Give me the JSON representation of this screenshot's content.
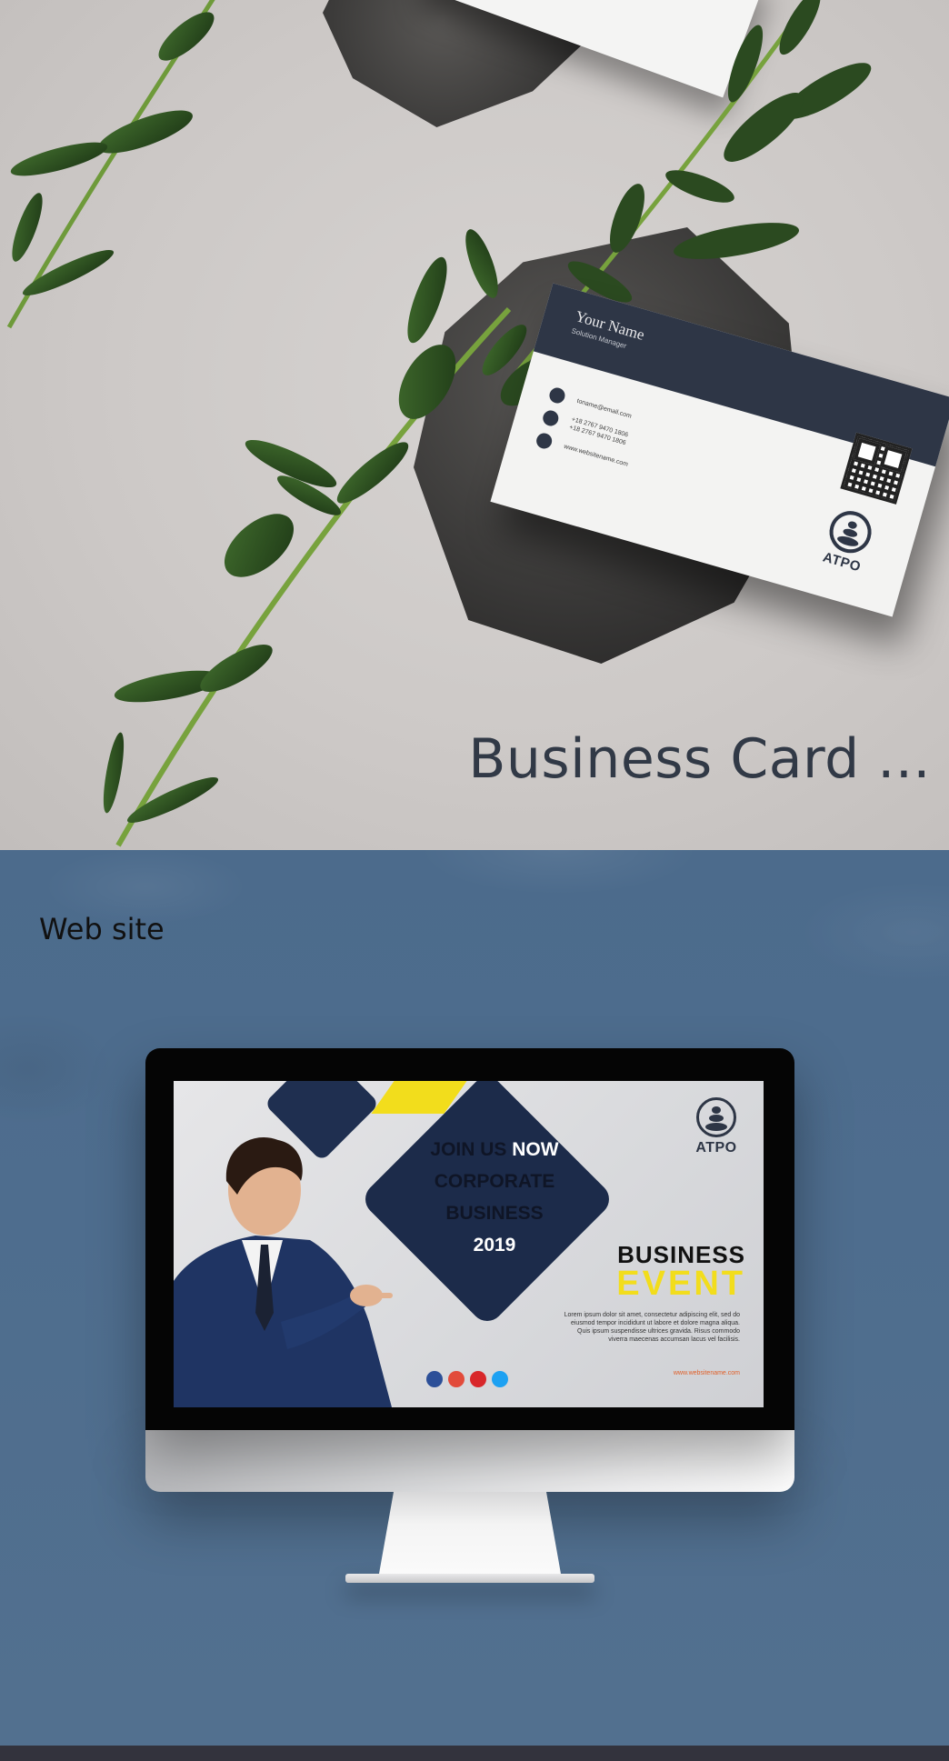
{
  "business_card_section": {
    "title": "Business Card ...",
    "card": {
      "name": "Your Name",
      "role": "Solution Manager",
      "email": "toname@email.com",
      "phones": [
        "+18 2767 9470 1806",
        "+18 2767 9470 1806"
      ],
      "website": "www.websitename.com",
      "logo_text": "ATPO"
    }
  },
  "website_section": {
    "label": "Web site",
    "screen": {
      "headline_join": "JOIN US",
      "headline_now": "NOW",
      "headline_corporate": "CORPORATE",
      "headline_business": "BUSINESS",
      "headline_year": "2019",
      "logo_text": "ATPO",
      "event_line1": "BUSINESS",
      "event_line2": "EVENT",
      "lorem": "Lorem ipsum dolor sit amet, consectetur adipiscing elit, sed do eiusmod tempor incididunt ut labore et dolore magna aliqua. Quis ipsum suspendisse ultrices gravida. Risus commodo viverra maecenas accumsan lacus vel facilisis.",
      "url": "www.websitename.com",
      "social_icons": [
        "facebook-icon",
        "google-plus-icon",
        "youtube-icon",
        "twitter-icon"
      ],
      "social_colors": [
        "#2c4f98",
        "#e24b3b",
        "#d8272a",
        "#1da1f2"
      ]
    }
  },
  "colors": {
    "navy": "#2e3646",
    "accent_yellow": "#f2dd1c",
    "section_blue": "#4e6d8e"
  }
}
